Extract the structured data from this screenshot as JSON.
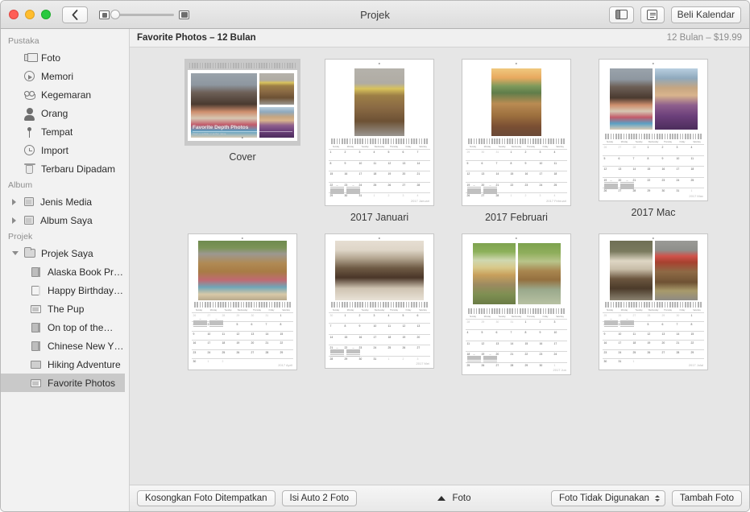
{
  "window": {
    "title": "Projek",
    "traffic_lights": [
      "close-button",
      "minimize-button",
      "zoom-button"
    ],
    "back_label": "‹",
    "zoom_slider": {
      "min_icon": "small-thumbnail-icon",
      "max_icon": "large-thumbnail-icon",
      "value": 0
    },
    "buy_button": "Beli Kalendar",
    "sidebar_toggle_icon": "sidebar-toggle-icon",
    "info_icon": "info-panel-icon"
  },
  "sidebar": {
    "sections": [
      {
        "header": "Pustaka",
        "items": [
          {
            "label": "Foto",
            "icon": "photos-icon",
            "indent": 0,
            "disclosure": "none",
            "selected": false
          },
          {
            "label": "Memori",
            "icon": "memories-icon",
            "indent": 0,
            "disclosure": "none",
            "selected": false
          },
          {
            "label": "Kegemaran",
            "icon": "heart-icon",
            "indent": 0,
            "disclosure": "none",
            "selected": false
          },
          {
            "label": "Orang",
            "icon": "people-icon",
            "indent": 0,
            "disclosure": "none",
            "selected": false
          },
          {
            "label": "Tempat",
            "icon": "places-pin-icon",
            "indent": 0,
            "disclosure": "none",
            "selected": false
          },
          {
            "label": "Import",
            "icon": "import-clock-icon",
            "indent": 0,
            "disclosure": "none",
            "selected": false
          },
          {
            "label": "Terbaru Dipadam",
            "icon": "trash-icon",
            "indent": 0,
            "disclosure": "none",
            "selected": false
          }
        ]
      },
      {
        "header": "Album",
        "items": [
          {
            "label": "Jenis Media",
            "icon": "album-icon",
            "indent": 0,
            "disclosure": "closed",
            "selected": false
          },
          {
            "label": "Album Saya",
            "icon": "album-icon",
            "indent": 0,
            "disclosure": "closed",
            "selected": false
          }
        ]
      },
      {
        "header": "Projek",
        "items": [
          {
            "label": "Projek Saya",
            "icon": "folder-icon",
            "indent": 0,
            "disclosure": "open",
            "selected": false
          },
          {
            "label": "Alaska Book Pr…",
            "icon": "book-icon",
            "indent": 1,
            "disclosure": "none",
            "selected": false
          },
          {
            "label": "Happy Birthday…",
            "icon": "card-icon",
            "indent": 1,
            "disclosure": "none",
            "selected": false
          },
          {
            "label": "The Pup",
            "icon": "calendar-icon",
            "indent": 1,
            "disclosure": "none",
            "selected": false
          },
          {
            "label": "On top of the…",
            "icon": "book-icon",
            "indent": 1,
            "disclosure": "none",
            "selected": false
          },
          {
            "label": "Chinese New Y…",
            "icon": "book-icon",
            "indent": 1,
            "disclosure": "none",
            "selected": false
          },
          {
            "label": "Hiking Adventure",
            "icon": "slideshow-icon",
            "indent": 1,
            "disclosure": "none",
            "selected": false
          },
          {
            "label": "Favorite Photos",
            "icon": "calendar-icon",
            "indent": 1,
            "disclosure": "none",
            "selected": true
          }
        ]
      }
    ]
  },
  "content_header": {
    "title": "Favorite Photos – 12 Bulan",
    "price": "12 Bulan – $19.99"
  },
  "pages": [
    {
      "caption": "Cover",
      "type": "cover",
      "selected": true,
      "cover_title": "Favorite Depth Photos",
      "cover_subtitle": "Insert a subtitle or author name",
      "photos": [
        "curly-hair-woman",
        "dog-with-crown",
        "blonde-woman"
      ]
    },
    {
      "caption": "2017 Januari",
      "type": "month",
      "selected": false,
      "month_label": "2017 Januari",
      "layout": "single-portrait",
      "photos": [
        "dog-with-crown"
      ],
      "weekday_headers": [
        "Sunday",
        "Monday",
        "Tuesday",
        "Wednesday",
        "Thursday",
        "Friday",
        "Saturday"
      ],
      "weeks": [
        [
          "1",
          "2",
          "3",
          "4",
          "5",
          "6",
          "7"
        ],
        [
          "8",
          "9",
          "10",
          "11",
          "12",
          "13",
          "14"
        ],
        [
          "15",
          "16",
          "17",
          "18",
          "19",
          "20",
          "21"
        ],
        [
          "22",
          "23",
          "24",
          "25",
          "26",
          "27",
          "28"
        ],
        [
          "29",
          "30",
          "31",
          "1",
          "2",
          "3",
          "4"
        ]
      ],
      "dim_last_row_from": 3,
      "mini_position": "bottom-left"
    },
    {
      "caption": "2017 Februari",
      "type": "month",
      "selected": false,
      "month_label": "2017 Februari",
      "layout": "single-portrait",
      "photos": [
        "dog-at-sunset"
      ],
      "weekday_headers": [
        "Sunday",
        "Monday",
        "Tuesday",
        "Wednesday",
        "Thursday",
        "Friday",
        "Saturday"
      ],
      "weeks": [
        [
          "29",
          "30",
          "31",
          "1",
          "2",
          "3",
          "4"
        ],
        [
          "5",
          "6",
          "7",
          "8",
          "9",
          "10",
          "11"
        ],
        [
          "12",
          "13",
          "14",
          "15",
          "16",
          "17",
          "18"
        ],
        [
          "19",
          "20",
          "21",
          "22",
          "23",
          "24",
          "25"
        ],
        [
          "26",
          "27",
          "28",
          "1",
          "2",
          "3",
          "4"
        ]
      ],
      "dim_last_row_from": 3,
      "mini_position": "bottom-left"
    },
    {
      "caption": "2017 Mac",
      "type": "month",
      "selected": false,
      "month_label": "2017 Mac",
      "layout": "two-portrait",
      "photos": [
        "curly-hair-woman",
        "blonde-woman"
      ],
      "weekday_headers": [
        "Sunday",
        "Monday",
        "Tuesday",
        "Wednesday",
        "Thursday",
        "Friday",
        "Saturday"
      ],
      "weeks": [
        [
          "26",
          "27",
          "28",
          "1",
          "2",
          "3",
          "4"
        ],
        [
          "5",
          "6",
          "7",
          "8",
          "9",
          "10",
          "11"
        ],
        [
          "12",
          "13",
          "14",
          "15",
          "16",
          "17",
          "18"
        ],
        [
          "19",
          "20",
          "21",
          "22",
          "23",
          "24",
          "25"
        ],
        [
          "26",
          "27",
          "28",
          "29",
          "30",
          "31",
          "1"
        ]
      ],
      "dim_last_row_from": 6,
      "mini_position": "bottom-left"
    },
    {
      "caption": "",
      "type": "month",
      "selected": false,
      "month_label": "2017 April",
      "layout": "single-landscape",
      "photos": [
        "dog-lying-on-blanket"
      ],
      "weekday_headers": [
        "Sunday",
        "Monday",
        "Tuesday",
        "Wednesday",
        "Thursday",
        "Friday",
        "Saturday"
      ],
      "weeks": [
        [
          "26",
          "27",
          "28",
          "29",
          "30",
          "31",
          "1"
        ],
        [
          "2",
          "3",
          "4",
          "5",
          "6",
          "7",
          "8"
        ],
        [
          "9",
          "10",
          "11",
          "12",
          "13",
          "14",
          "15"
        ],
        [
          "16",
          "17",
          "18",
          "19",
          "20",
          "21",
          "22"
        ],
        [
          "23",
          "24",
          "25",
          "26",
          "27",
          "28",
          "29"
        ],
        [
          "30",
          "1",
          "2",
          "",
          "",
          "",
          ""
        ]
      ],
      "dim_last_row_from": 1,
      "mini_position": "top-left"
    },
    {
      "caption": "",
      "type": "month",
      "selected": false,
      "month_label": "2017 Mei",
      "layout": "single-landscape",
      "photos": [
        "dog-in-hood"
      ],
      "weekday_headers": [
        "Sunday",
        "Monday",
        "Tuesday",
        "Wednesday",
        "Thursday",
        "Friday",
        "Saturday"
      ],
      "weeks": [
        [
          "30",
          "1",
          "2",
          "3",
          "4",
          "5",
          "6"
        ],
        [
          "7",
          "8",
          "9",
          "10",
          "11",
          "12",
          "13"
        ],
        [
          "14",
          "15",
          "16",
          "17",
          "18",
          "19",
          "20"
        ],
        [
          "21",
          "22",
          "23",
          "24",
          "25",
          "26",
          "27"
        ],
        [
          "28",
          "29",
          "30",
          "31",
          "1",
          "2",
          "3"
        ]
      ],
      "dim_last_row_from": 4,
      "mini_position": "bottom-left"
    },
    {
      "caption": "",
      "type": "month",
      "selected": false,
      "month_label": "2017 Jun",
      "layout": "two-portrait",
      "photos": [
        "girl-in-hammock-with-dog",
        "dog-in-river"
      ],
      "weekday_headers": [
        "Sunday",
        "Monday",
        "Tuesday",
        "Wednesday",
        "Thursday",
        "Friday",
        "Saturday"
      ],
      "weeks": [
        [
          "28",
          "29",
          "30",
          "31",
          "1",
          "2",
          "3"
        ],
        [
          "4",
          "5",
          "6",
          "7",
          "8",
          "9",
          "10"
        ],
        [
          "11",
          "12",
          "13",
          "14",
          "15",
          "16",
          "17"
        ],
        [
          "18",
          "19",
          "20",
          "21",
          "22",
          "23",
          "24"
        ],
        [
          "25",
          "26",
          "27",
          "28",
          "29",
          "30",
          "1"
        ]
      ],
      "dim_last_row_from": 6,
      "mini_position": "bottom-left"
    },
    {
      "caption": "",
      "type": "month",
      "selected": false,
      "month_label": "2017 Julai",
      "layout": "two-portrait",
      "photos": [
        "dog-in-white-hat",
        "dog-with-party-hat"
      ],
      "weekday_headers": [
        "Sunday",
        "Monday",
        "Tuesday",
        "Wednesday",
        "Thursday",
        "Friday",
        "Saturday"
      ],
      "weeks": [
        [
          "25",
          "26",
          "27",
          "28",
          "29",
          "30",
          "1"
        ],
        [
          "2",
          "3",
          "4",
          "5",
          "6",
          "7",
          "8"
        ],
        [
          "9",
          "10",
          "11",
          "12",
          "13",
          "14",
          "15"
        ],
        [
          "16",
          "17",
          "18",
          "19",
          "20",
          "21",
          "22"
        ],
        [
          "23",
          "24",
          "25",
          "26",
          "27",
          "28",
          "29"
        ],
        [
          "30",
          "31",
          "1",
          "",
          "",
          "",
          ""
        ]
      ],
      "dim_last_row_from": 2,
      "mini_position": "top-left"
    }
  ],
  "bottom_bar": {
    "clear_placed_label": "Kosongkan Foto Ditempatkan",
    "autofill_label": "Isi Auto 2 Foto",
    "tray_toggle_icon": "chevron-up-icon",
    "tray_label": "Foto",
    "filter_popup_label": "Foto Tidak Digunakan",
    "add_photos_label": "Tambah Foto"
  },
  "colors": {
    "titlebar_top": "#ededed",
    "titlebar_bottom": "#dcdcdc",
    "sidebar_bg": "#f2f2f2",
    "selection": "#c9c9c9",
    "canvas_bg": "#e6e6e6",
    "traffic_red": "#ff5f57",
    "traffic_yellow": "#ffbd2e",
    "traffic_green": "#28c940"
  }
}
